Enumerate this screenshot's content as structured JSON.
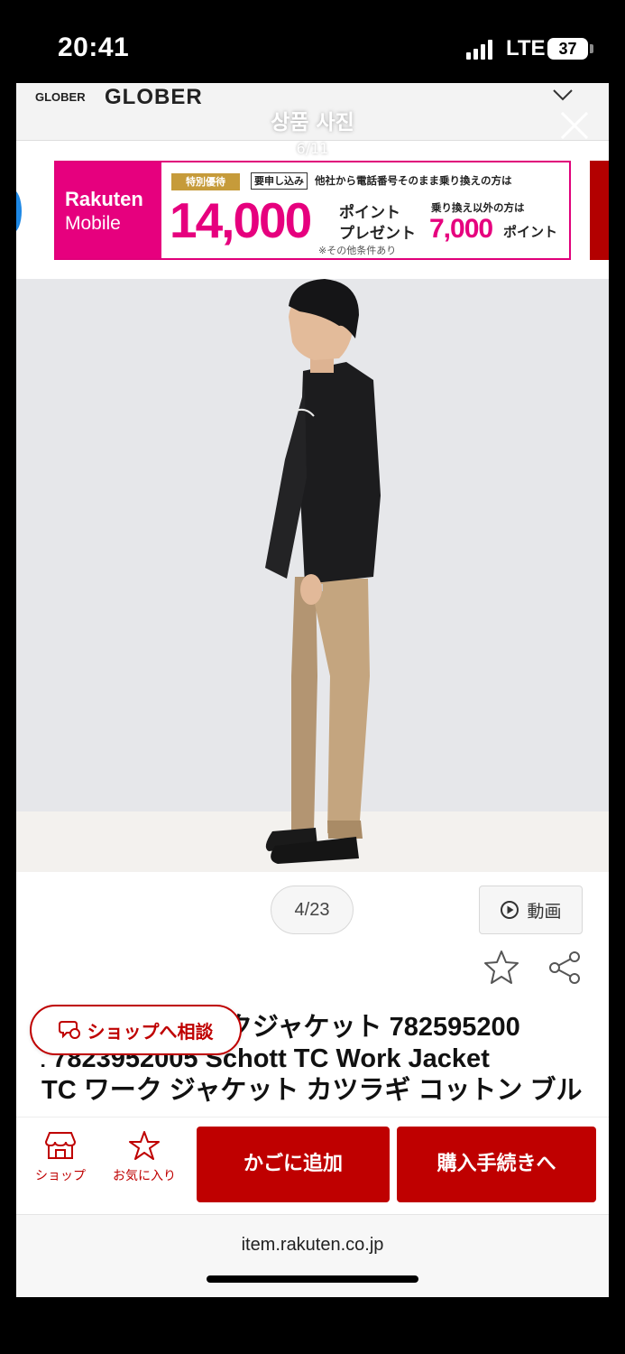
{
  "status_bar": {
    "time": "20:41",
    "network": "LTE",
    "battery": "37"
  },
  "site": {
    "brand_small": "GLOBER",
    "brand_large": "GLOBER"
  },
  "viewer": {
    "title": "상품 사진",
    "counter": "6/11"
  },
  "banner": {
    "logo_line1": "Rakuten",
    "logo_line2": "Mobile",
    "tag": "特別優待",
    "apply": "要申し込み",
    "condition": "他社から電話番号そのまま乗り換えの方は",
    "amount": "14,000",
    "points_line1": "ポイント",
    "points_line2": "プレゼント",
    "other_condition": "乗り換え以外の方は",
    "amount2": "7,000",
    "points_suffix": "ポイント",
    "note": "※その他条件あり"
  },
  "gallery": {
    "pager": "4/23",
    "video_label": "動画"
  },
  "product": {
    "title_lines": [
      "クジャケット 782595200",
      "1 7823952005 Schott TC Work Jacket",
      "TC ワーク ジャケット カツラギ コットン ブル"
    ]
  },
  "chat_button": "ショップへ相談",
  "action_bar": {
    "shop_label": "ショップ",
    "favorite_label": "お気に入り",
    "cart_label": "かごに追加",
    "buy_label": "購入手続きへ"
  },
  "browser": {
    "url": "item.rakuten.co.jp"
  },
  "colors": {
    "rakuten_red": "#bf0000",
    "banner_pink": "#e6007e",
    "background": "#ffffff"
  },
  "icons": [
    "search-icon",
    "close-icon",
    "chevron-down-icon",
    "play-icon",
    "star-icon",
    "share-icon",
    "chat-icon",
    "shop-icon"
  ]
}
